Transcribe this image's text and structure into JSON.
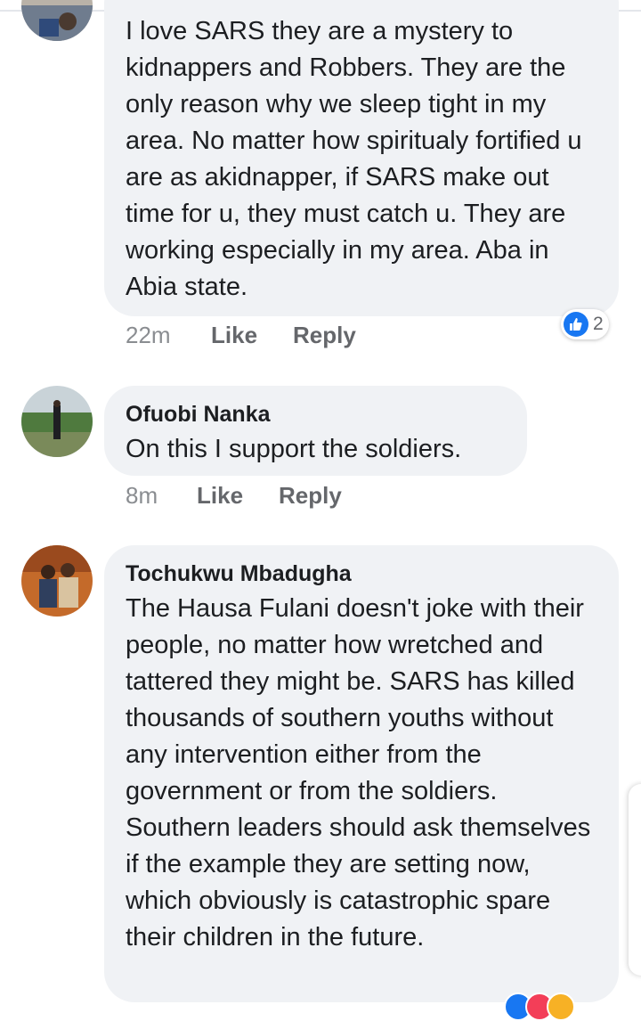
{
  "comments": [
    {
      "author": "",
      "text": "I love SARS they are a mystery to kidnappers and Robbers. They are the only reason why we sleep tight in my area. No matter how spiritualy fortified u are as akidnapper, if SARS make out time for u, they must catch u. They are working especially in my area. Aba in Abia state.",
      "time": "22m",
      "like_label": "Like",
      "reply_label": "Reply",
      "reaction_count": "2"
    },
    {
      "author": "Ofuobi Nanka",
      "text": "On this I support the soldiers.",
      "time": "8m",
      "like_label": "Like",
      "reply_label": "Reply"
    },
    {
      "author": "Tochukwu Mbadugha",
      "text": "The Hausa Fulani doesn't joke with their people, no matter how wretched and tattered they might be. SARS has killed thousands of southern youths without any intervention either from the government or from the soldiers. Southern leaders should ask themselves if the example they are setting now, which obviously is catastrophic spare their children in the future."
    }
  ],
  "colors": {
    "bubble": "#f0f2f5",
    "like_blue": "#1877f2",
    "meta_gray": "#65676b"
  }
}
